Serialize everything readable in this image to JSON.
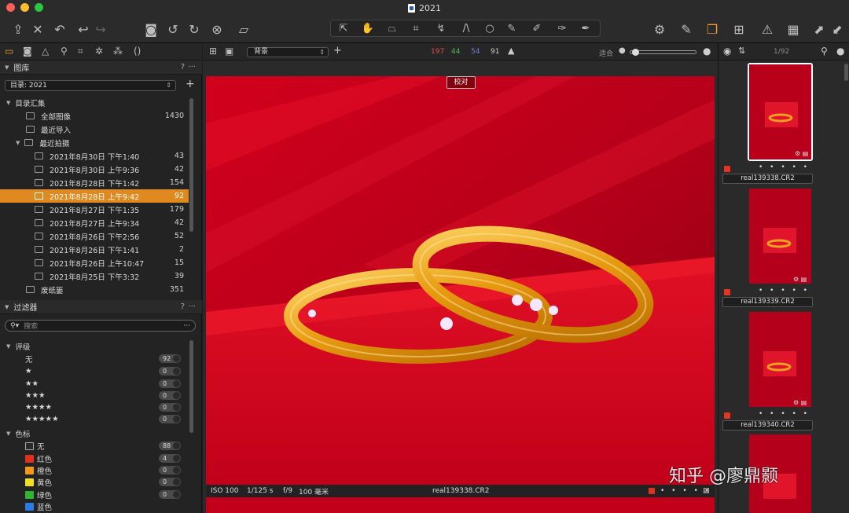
{
  "window": {
    "title": "2021"
  },
  "toolbar": {
    "icons": [
      "import-icon",
      "delete-icon",
      "undo-icon",
      "undo-back-icon",
      "redo-icon",
      "camera-icon",
      "rotate-left-icon",
      "rotate-right-icon",
      "reset-icon",
      "crop-mask-icon",
      "pointer-icon",
      "hand-icon",
      "keystone-icon",
      "crop-icon",
      "straighten-icon",
      "heal-icon",
      "circle-icon",
      "brush-icon",
      "eraser-icon",
      "gradient-icon",
      "picker-icon",
      "settings-icon",
      "edit-icon",
      "layers-icon",
      "warning-icon",
      "grid-icon",
      "filmstrip-icon",
      "expand-icon",
      "collapse-icon"
    ]
  },
  "left": {
    "tabs": [
      "folder-tab",
      "camera-tab",
      "exposure-tab",
      "search-tab",
      "crop-tab",
      "settings-tab",
      "details-tab",
      "metadata-tab"
    ],
    "library": {
      "title": "图库",
      "help": "?",
      "menu": "···",
      "catalog": "目录: 2021",
      "group": "目录汇集",
      "items": [
        {
          "label": "全部图像",
          "count": "1430"
        },
        {
          "label": "最近导入",
          "count": ""
        },
        {
          "label": "最近拍摄",
          "count": ""
        },
        {
          "label": "2021年8月30日 下午1:40",
          "count": "43"
        },
        {
          "label": "2021年8月30日 上午9:36",
          "count": "42"
        },
        {
          "label": "2021年8月28日 下午1:42",
          "count": "154"
        },
        {
          "label": "2021年8月28日 上午9:42",
          "count": "92"
        },
        {
          "label": "2021年8月27日 下午1:35",
          "count": "179"
        },
        {
          "label": "2021年8月27日 上午9:34",
          "count": "42"
        },
        {
          "label": "2021年8月26日 下午2:56",
          "count": "52"
        },
        {
          "label": "2021年8月26日 下午1:41",
          "count": "2"
        },
        {
          "label": "2021年8月26日 上午10:47",
          "count": "15"
        },
        {
          "label": "2021年8月25日 下午3:32",
          "count": "39"
        },
        {
          "label": "废纸篓",
          "count": "351"
        }
      ]
    },
    "filter": {
      "title": "过滤器",
      "help": "?",
      "menu": "···",
      "search_placeholder": "搜索",
      "rating_title": "评级",
      "ratings": [
        {
          "label": "无",
          "count": "92"
        },
        {
          "label": "★",
          "count": "0"
        },
        {
          "label": "★★",
          "count": "0"
        },
        {
          "label": "★★★",
          "count": "0"
        },
        {
          "label": "★★★★",
          "count": "0"
        },
        {
          "label": "★★★★★",
          "count": "0"
        }
      ],
      "color_title": "色标",
      "colors": [
        {
          "label": "无",
          "count": "88",
          "color": "#2a2a2a"
        },
        {
          "label": "红色",
          "count": "4",
          "color": "#e3301c"
        },
        {
          "label": "橙色",
          "count": "0",
          "color": "#f09a1a"
        },
        {
          "label": "黄色",
          "count": "0",
          "color": "#f0e020"
        },
        {
          "label": "绿色",
          "count": "0",
          "color": "#2fb52f"
        },
        {
          "label": "蓝色",
          "count": "",
          "color": "#2a7de0"
        }
      ]
    }
  },
  "center": {
    "layer": "背景",
    "hist": {
      "r": "197",
      "g": "44",
      "b": "54",
      "l": "91"
    },
    "fit": "适合",
    "proof_label": "校对",
    "exif": {
      "iso": "ISO 100",
      "shutter": "1/125 s",
      "aperture": "f/9",
      "focal": "100 毫米",
      "filename": "real139338.CR2"
    }
  },
  "right": {
    "count": "1/92",
    "thumbs": [
      {
        "filename": "real139338.CR2",
        "stars": "• • • • •"
      },
      {
        "filename": "real139339.CR2",
        "stars": "• • • • •"
      },
      {
        "filename": "real139340.CR2",
        "stars": "• • • • •"
      }
    ]
  },
  "watermark": "知乎 @廖鼎颢"
}
